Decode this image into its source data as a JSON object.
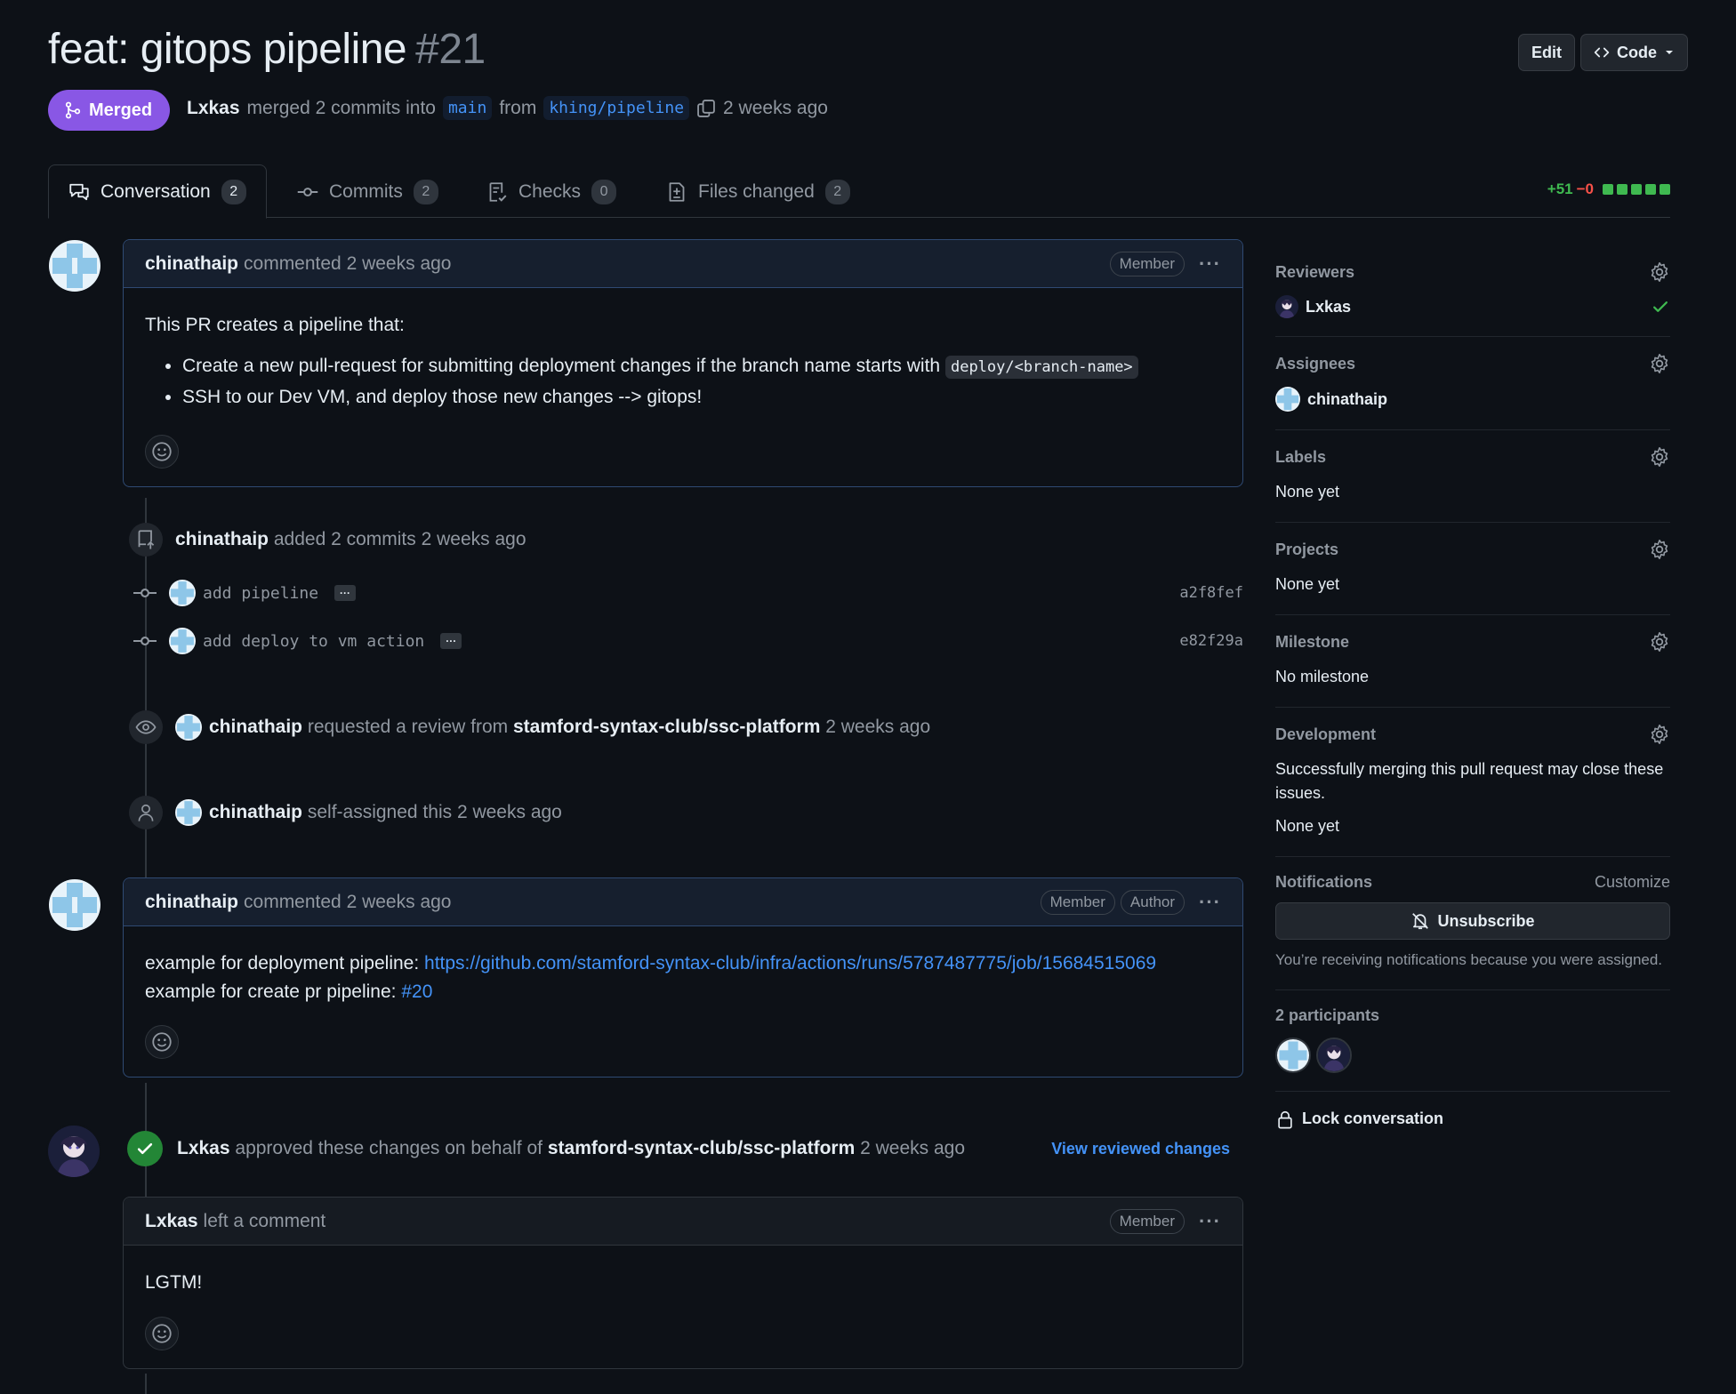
{
  "pr": {
    "title": "feat: gitops pipeline",
    "number": "#21",
    "status": "Merged",
    "author": "Lxkas",
    "merge_text": "merged 2 commits into",
    "base_branch": "main",
    "from_text": "from",
    "head_branch": "khing/pipeline",
    "time": "2 weeks ago"
  },
  "header_buttons": {
    "edit": "Edit",
    "code": "Code"
  },
  "tabs": [
    {
      "label": "Conversation",
      "count": "2"
    },
    {
      "label": "Commits",
      "count": "2"
    },
    {
      "label": "Checks",
      "count": "0"
    },
    {
      "label": "Files changed",
      "count": "2"
    }
  ],
  "diffstat": {
    "additions": "+51",
    "deletions": "−0"
  },
  "timeline": {
    "comment1": {
      "author": "chinathaip",
      "action": "commented 2 weeks ago",
      "roles": [
        "Member"
      ],
      "intro": "This PR creates a pipeline that:",
      "bullet1": "Create a new pull-request for submitting deployment changes if the branch name starts with",
      "bullet1_code": "deploy/<branch-name>",
      "bullet2": "SSH to our Dev VM, and deploy those new changes --> gitops!"
    },
    "commits_event": {
      "author": "chinathaip",
      "text": "added 2 commits 2 weeks ago"
    },
    "commits": [
      {
        "message": "add pipeline",
        "sha": "a2f8fef"
      },
      {
        "message": "add deploy to vm action",
        "sha": "e82f29a"
      }
    ],
    "review_request": {
      "author": "chinathaip",
      "text": "requested a review from",
      "team": "stamford-syntax-club/ssc-platform",
      "time": "2 weeks ago"
    },
    "self_assign": {
      "author": "chinathaip",
      "text": "self-assigned this 2 weeks ago"
    },
    "comment2": {
      "author": "chinathaip",
      "action": "commented 2 weeks ago",
      "roles": [
        "Member",
        "Author"
      ],
      "line1_label": "example for deployment pipeline:",
      "line1_link": "https://github.com/stamford-syntax-club/infra/actions/runs/5787487775/job/15684515069",
      "line2_label": "example for create pr pipeline:",
      "line2_link": "#20"
    },
    "approval": {
      "author": "Lxkas",
      "text": "approved these changes on behalf of",
      "team": "stamford-syntax-club/ssc-platform",
      "time": "2 weeks ago",
      "view_link": "View reviewed changes"
    },
    "review_comment": {
      "author": "Lxkas",
      "action": "left a comment",
      "roles": [
        "Member"
      ],
      "body": "LGTM!"
    }
  },
  "sidebar": {
    "reviewers": {
      "title": "Reviewers",
      "name": "Lxkas"
    },
    "assignees": {
      "title": "Assignees",
      "name": "chinathaip"
    },
    "labels": {
      "title": "Labels",
      "value": "None yet"
    },
    "projects": {
      "title": "Projects",
      "value": "None yet"
    },
    "milestone": {
      "title": "Milestone",
      "value": "No milestone"
    },
    "development": {
      "title": "Development",
      "desc": "Successfully merging this pull request may close these issues.",
      "value": "None yet"
    },
    "notifications": {
      "title": "Notifications",
      "customize": "Customize",
      "button": "Unsubscribe",
      "note": "You’re receiving notifications because you were assigned."
    },
    "participants": {
      "title": "2 participants"
    },
    "lock": "Lock conversation"
  },
  "colors": {
    "merged": "#8957e5",
    "link": "#4493f8",
    "addition": "#3fb950",
    "deletion": "#f85149"
  }
}
